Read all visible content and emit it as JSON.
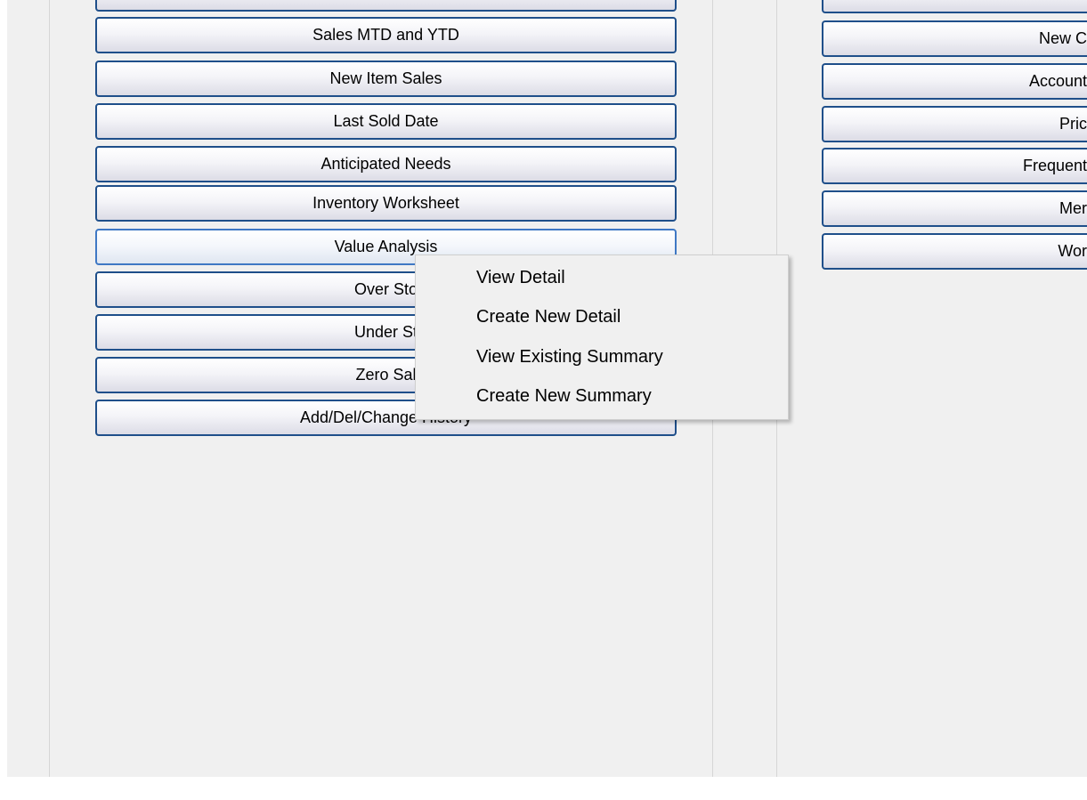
{
  "left_buttons": [
    {
      "label": "Sales MTD and YTD"
    },
    {
      "label": "New Item Sales"
    },
    {
      "label": "Last Sold Date"
    },
    {
      "label": "Anticipated Needs"
    },
    {
      "label": "Inventory Worksheet"
    },
    {
      "label": "Value Analysis"
    },
    {
      "label": "Over Sto"
    },
    {
      "label": "Under St"
    },
    {
      "label": "Zero Sal"
    },
    {
      "label": "Add/Del/Change History"
    }
  ],
  "right_buttons": [
    {
      "label": "New C"
    },
    {
      "label": "Account"
    },
    {
      "label": "Pric"
    },
    {
      "label": "Frequent"
    },
    {
      "label": "Mer"
    },
    {
      "label": "Wor"
    }
  ],
  "context_menu": {
    "items": [
      {
        "label": "View Detail"
      },
      {
        "label": "Create New Detail"
      },
      {
        "label": "View Existing Summary"
      },
      {
        "label": "Create New Summary"
      }
    ]
  }
}
